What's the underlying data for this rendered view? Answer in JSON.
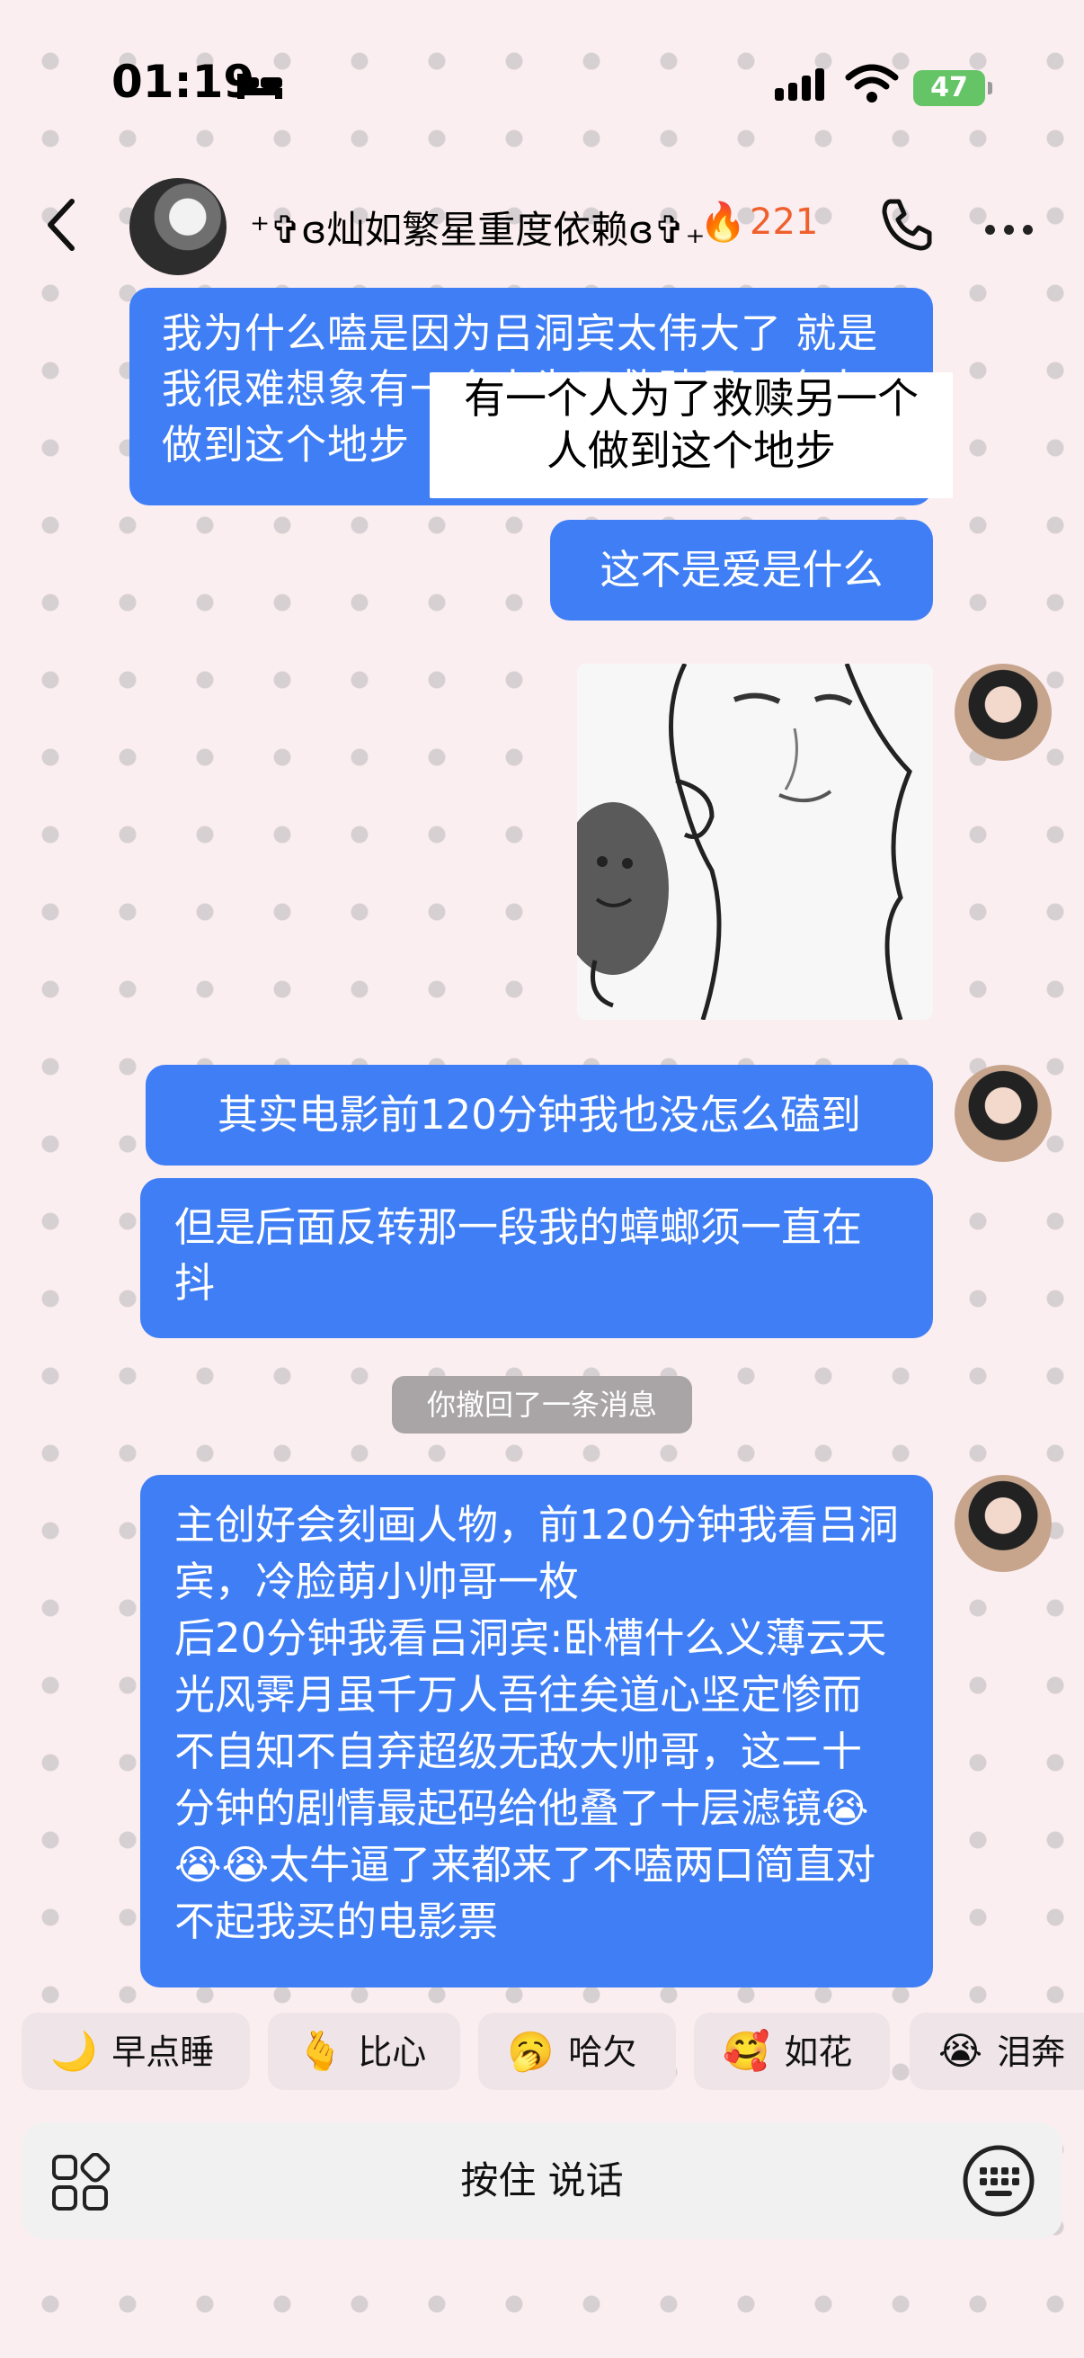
{
  "status_bar": {
    "time": "01:19",
    "battery": "47"
  },
  "header": {
    "name": "⁺✞ɞ灿如繁星重度依赖ɞ✞₊",
    "streak_count": "221"
  },
  "messages": {
    "m1": "我为什么嗑是因为吕洞宾太伟大了 就是我很难想象有一个人为了救赎另一个人做到这个地步",
    "m1_overlay": [
      "有一个人为了救赎另一个",
      "人做到这个地步"
    ],
    "m2": "这不是爱是什么",
    "m3": "其实电影前120分钟我也没怎么磕到",
    "m4": "但是后面反转那一段我的蟑螂须一直在抖",
    "recall": "你撤回了一条消息",
    "m5": "主创好会刻画人物，前120分钟我看吕洞宾，冷脸萌小帅哥一枚\n后20分钟我看吕洞宾:卧槽什么义薄云天光风霁月虽千万人吾往矣道心坚定惨而不自知不自弃超级无敌大帅哥，这二十分钟的剧情最起码给他叠了十层滤镜😭😭😭太牛逼了来都来了不嗑两口简直对不起我买的电影票"
  },
  "quick_replies": [
    {
      "emoji": "🌙",
      "label": "早点睡"
    },
    {
      "emoji": "🫰",
      "label": "比心"
    },
    {
      "emoji": "🥱",
      "label": "哈欠"
    },
    {
      "emoji": "🥰",
      "label": "如花"
    },
    {
      "emoji": "😭",
      "label": "泪奔"
    }
  ],
  "input": {
    "hold_to_talk": "按住 说话"
  },
  "colors": {
    "bubble": "#3f7ef4",
    "background": "#fbeef1",
    "streak": "#f0602c"
  }
}
